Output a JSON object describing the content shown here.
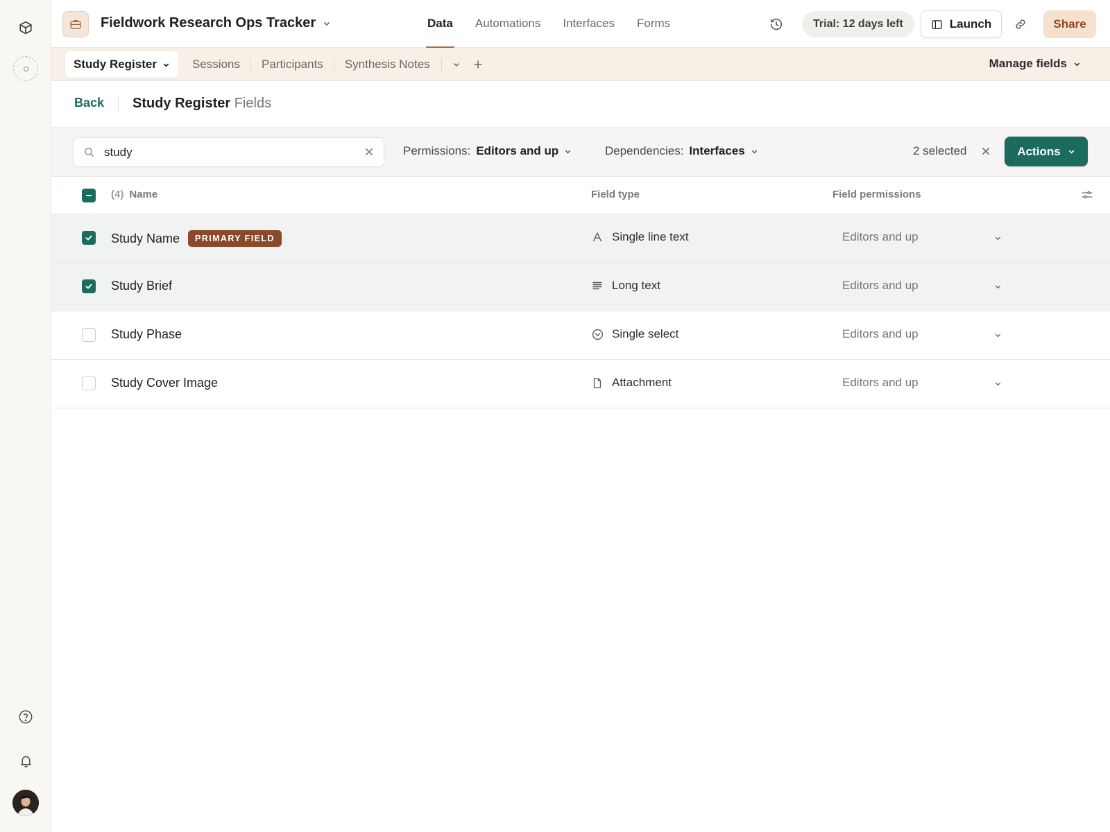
{
  "app": {
    "base_title": "Fieldwork Research Ops Tracker",
    "nav_tabs": [
      "Data",
      "Automations",
      "Interfaces",
      "Forms"
    ],
    "active_nav": "Data",
    "trial_text": "Trial: 12 days left",
    "launch_label": "Launch",
    "share_label": "Share"
  },
  "tables": {
    "active": "Study Register",
    "others": [
      "Sessions",
      "Participants",
      "Synthesis Notes"
    ],
    "manage_fields_label": "Manage fields"
  },
  "header": {
    "back_label": "Back",
    "title_strong": "Study Register",
    "title_muted": "Fields"
  },
  "toolbar": {
    "search_value": "study",
    "permissions_label": "Permissions:",
    "permissions_value": "Editors and up",
    "dependencies_label": "Dependencies:",
    "dependencies_value": "Interfaces",
    "selected_text": "2 selected",
    "actions_label": "Actions"
  },
  "table": {
    "count_label": "(4)",
    "columns": [
      "Name",
      "Field type",
      "Field permissions"
    ],
    "rows": [
      {
        "name": "Study Name",
        "badge": "PRIMARY FIELD",
        "type": "Single line text",
        "type_icon": "text-a-icon",
        "permission": "Editors and up",
        "selected": true
      },
      {
        "name": "Study Brief",
        "badge": "",
        "type": "Long text",
        "type_icon": "long-text-icon",
        "permission": "Editors and up",
        "selected": true
      },
      {
        "name": "Study Phase",
        "badge": "",
        "type": "Single select",
        "type_icon": "single-select-icon",
        "permission": "Editors and up",
        "selected": false
      },
      {
        "name": "Study Cover Image",
        "badge": "",
        "type": "Attachment",
        "type_icon": "attachment-icon",
        "permission": "Editors and up",
        "selected": false
      }
    ]
  },
  "colors": {
    "accent": "#1b6b5f",
    "brand": "#b3673d",
    "badge": "#8a4a2a",
    "table_bar_bg": "#f8efe7"
  }
}
